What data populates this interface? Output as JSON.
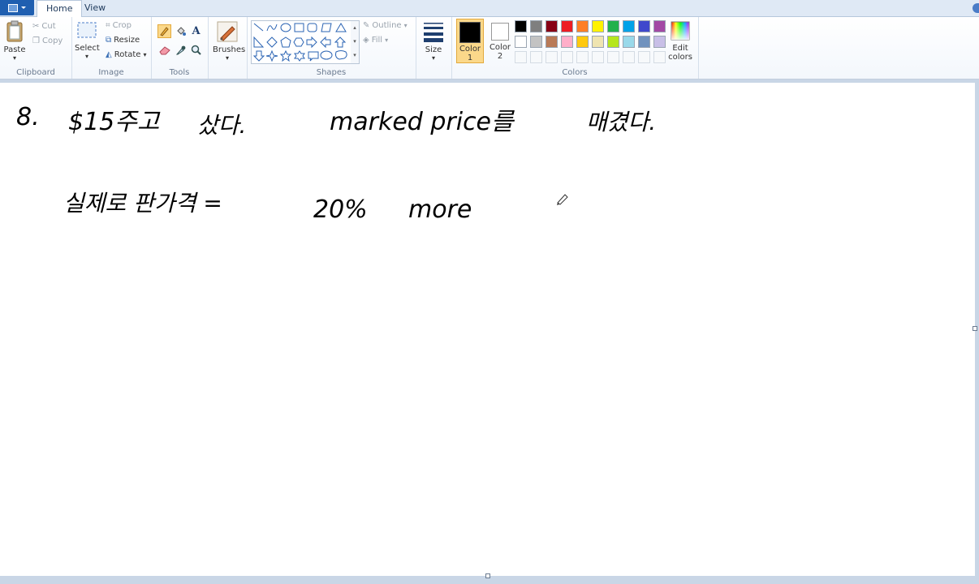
{
  "tabs": {
    "home": "Home",
    "view": "View"
  },
  "clipboard": {
    "paste": "Paste",
    "cut": "Cut",
    "copy": "Copy",
    "label": "Clipboard"
  },
  "image": {
    "select": "Select",
    "crop": "Crop",
    "resize": "Resize",
    "rotate": "Rotate",
    "label": "Image"
  },
  "tools": {
    "label": "Tools"
  },
  "brushes": {
    "label": "Brushes"
  },
  "shapes": {
    "outline": "Outline",
    "fill": "Fill",
    "label": "Shapes"
  },
  "size": {
    "label": "Size"
  },
  "colors": {
    "color1_label": "Color",
    "color1_num": "1",
    "color2_label": "Color",
    "color2_num": "2",
    "edit_label": "Edit",
    "edit_label2": "colors",
    "label": "Colors",
    "color1": "#000000",
    "color2": "#ffffff",
    "palette_row1": [
      "#000000",
      "#7f7f7f",
      "#880015",
      "#ed1c24",
      "#ff7f27",
      "#fff200",
      "#22b14c",
      "#00a2e8",
      "#3f48cc",
      "#a349a4"
    ],
    "palette_row2": [
      "#ffffff",
      "#c3c3c3",
      "#b97a57",
      "#ffaec9",
      "#ffc90e",
      "#efe4b0",
      "#b5e61d",
      "#99d9ea",
      "#7092be",
      "#c8bfe7"
    ]
  },
  "canvas_text": {
    "line1_num": "8.",
    "line1_a": "$15주고",
    "line1_b": "샀다.",
    "line1_c": "marked price를",
    "line1_d": "매겼다.",
    "line2_a": "실제로 판가격 =",
    "line2_b": "20%",
    "line2_c": "more"
  }
}
